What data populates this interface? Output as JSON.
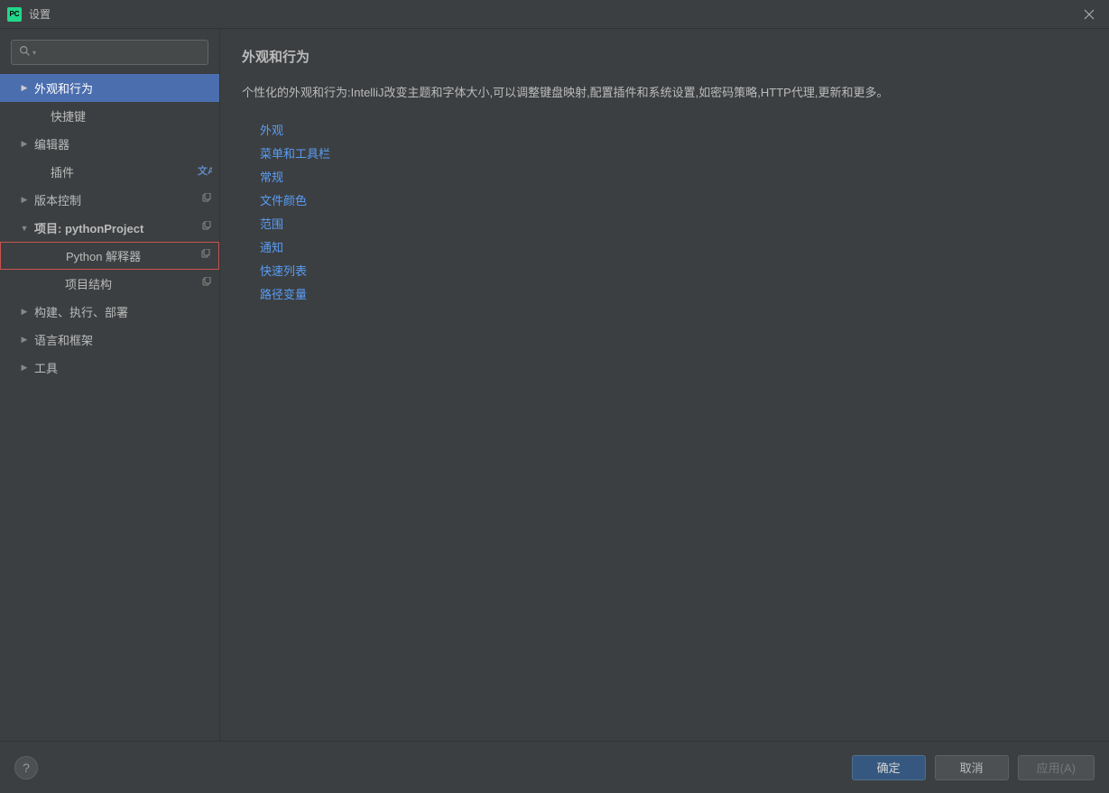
{
  "window": {
    "title": "设置",
    "app_icon_text": "PC"
  },
  "search": {
    "placeholder": ""
  },
  "sidebar": {
    "items": [
      {
        "label": "外观和行为",
        "chevron": "right",
        "selected": true,
        "indent": 0
      },
      {
        "label": "快捷键",
        "chevron": "none",
        "indent": 1
      },
      {
        "label": "编辑器",
        "chevron": "right",
        "indent": 0
      },
      {
        "label": "插件",
        "chevron": "none",
        "indent": 1,
        "badge": "translate"
      },
      {
        "label": "版本控制",
        "chevron": "right",
        "indent": 0,
        "badge": "copy"
      },
      {
        "label": "项目: pythonProject",
        "chevron": "down",
        "indent": 0,
        "bold": true,
        "badge": "copy"
      },
      {
        "label": "Python 解释器",
        "chevron": "none",
        "indent": 2,
        "badge": "copy",
        "highlighted": true
      },
      {
        "label": "项目结构",
        "chevron": "none",
        "indent": 2,
        "badge": "copy"
      },
      {
        "label": "构建、执行、部署",
        "chevron": "right",
        "indent": 0
      },
      {
        "label": "语言和框架",
        "chevron": "right",
        "indent": 0
      },
      {
        "label": "工具",
        "chevron": "right",
        "indent": 0
      }
    ]
  },
  "content": {
    "title": "外观和行为",
    "description": "个性化的外观和行为:IntelliJ改变主题和字体大小,可以调整键盘映射,配置插件和系统设置,如密码策略,HTTP代理,更新和更多。",
    "links": [
      "外观",
      "菜单和工具栏",
      "常规",
      "文件颜色",
      "范围",
      "通知",
      "快速列表",
      "路径变量"
    ]
  },
  "footer": {
    "help": "?",
    "ok": "确定",
    "cancel": "取消",
    "apply": "应用(A)"
  }
}
